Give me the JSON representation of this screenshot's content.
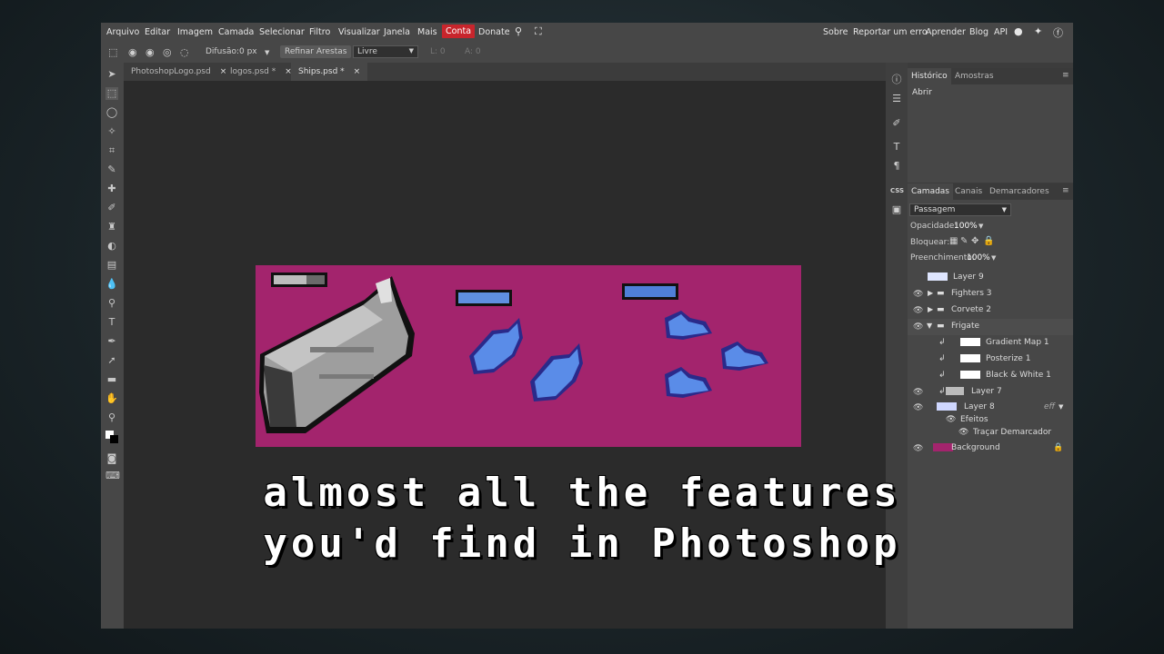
{
  "menu": {
    "items": [
      "Arquivo",
      "Editar",
      "Imagem",
      "Camada",
      "Selecionar",
      "Filtro",
      "Visualizar",
      "Janela",
      "Mais",
      "Conta",
      "Donate"
    ],
    "right": [
      "Sobre",
      "Reportar um erro",
      "Aprender",
      "Blog",
      "API"
    ]
  },
  "options": {
    "feather_label": "Difusão:",
    "feather_value": "0 px",
    "refine_label": "Refinar Arestas",
    "mode_value": "Livre",
    "width_field": "L: 0",
    "height_field": "A: 0"
  },
  "tabs": [
    {
      "label": "PhotoshopLogo.psd",
      "close": "×"
    },
    {
      "label": "logos.psd *",
      "close": "×"
    },
    {
      "label": "Ships.psd *",
      "close": "×"
    }
  ],
  "caption": {
    "line1": "almost all the features",
    "line2": "you'd find in Photoshop"
  },
  "history": {
    "tabs": [
      "Histórico",
      "Amostras"
    ],
    "items": [
      "Abrir"
    ]
  },
  "layers_panel": {
    "tabs": [
      "Camadas",
      "Canais",
      "Demarcadores"
    ],
    "blend_mode": "Passagem",
    "opacity_label": "Opacidade:",
    "opacity_value": "100%",
    "lock_label": "Bloquear:",
    "fill_label": "Preenchimento:",
    "fill_value": "100%",
    "layers": [
      {
        "name": "Layer 9"
      },
      {
        "name": "Fighters 3"
      },
      {
        "name": "Corvete 2"
      },
      {
        "name": "Frigate"
      },
      {
        "name": "Gradient Map 1"
      },
      {
        "name": "Posterize 1"
      },
      {
        "name": "Black & White 1"
      },
      {
        "name": "Layer 7"
      },
      {
        "name": "Layer 8"
      },
      {
        "name": "Efeitos"
      },
      {
        "name": "Traçar Demarcador"
      },
      {
        "name": "Background"
      }
    ],
    "fx_label": "eff"
  },
  "colors": {
    "canvas_bg": "#a3246d",
    "accent_red": "#c8252c"
  }
}
